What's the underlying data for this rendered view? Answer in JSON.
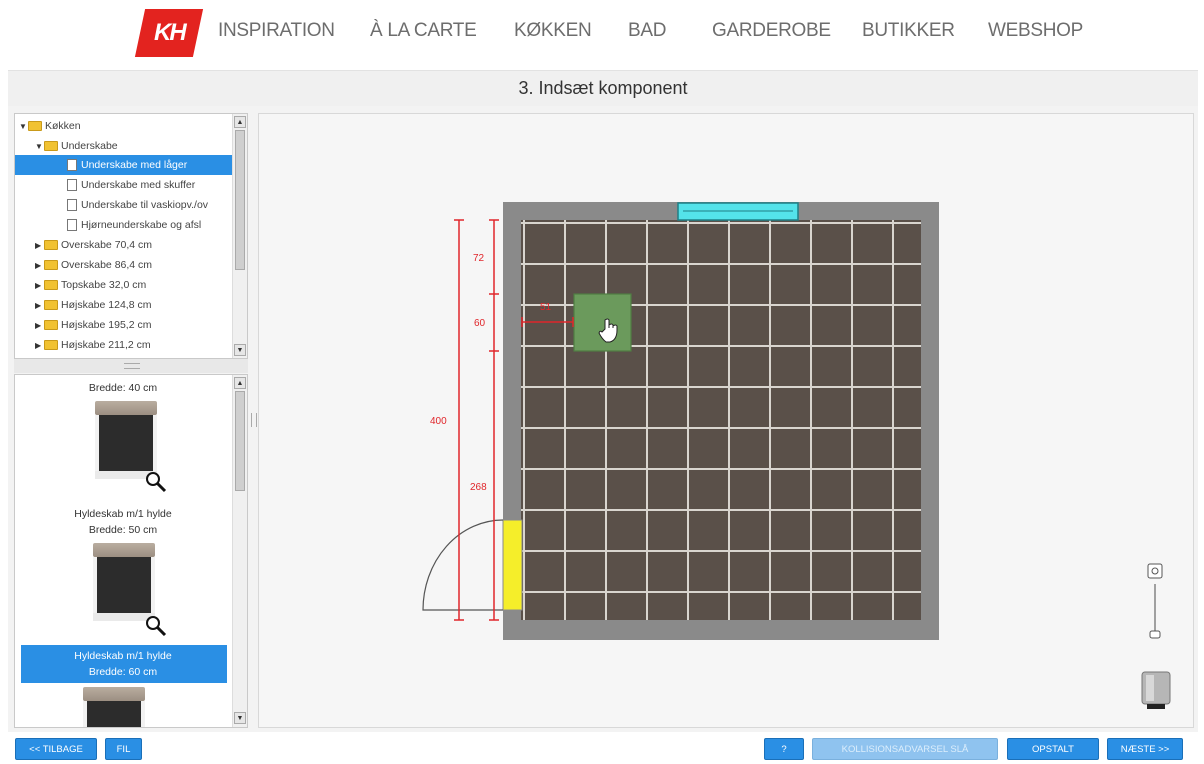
{
  "brand": {
    "logo_text": "KH"
  },
  "nav": [
    "INSPIRATION",
    "À LA CARTE",
    "KØKKEN",
    "BAD",
    "GARDEROBE",
    "BUTIKKER",
    "WEBSHOP"
  ],
  "title": "3. Indsæt komponent",
  "tree": [
    {
      "label": "Køkken",
      "type": "folder",
      "expanded": true
    },
    {
      "label": "Underskabe",
      "type": "folder",
      "expanded": true
    },
    {
      "label": "Underskabe med låger",
      "type": "doc",
      "selected": true
    },
    {
      "label": "Underskabe med skuffer",
      "type": "doc"
    },
    {
      "label": "Underskabe til vaskiopv./ov",
      "type": "doc"
    },
    {
      "label": "Hjørneunderskabe og afsl",
      "type": "doc"
    },
    {
      "label": "Overskabe 70,4 cm",
      "type": "folder"
    },
    {
      "label": "Overskabe 86,4 cm",
      "type": "folder"
    },
    {
      "label": "Topskabe 32,0 cm",
      "type": "folder"
    },
    {
      "label": "Højskabe 124,8 cm",
      "type": "folder"
    },
    {
      "label": "Højskabe 195,2 cm",
      "type": "folder"
    },
    {
      "label": "Højskabe 211,2 cm",
      "type": "folder"
    }
  ],
  "products": {
    "item0_width": "Bredde: 40 cm",
    "item1_name": "Hyldeskab m/1 hylde",
    "item1_width": "Bredde: 50 cm",
    "item2_name": "Hyldeskab m/1 hylde",
    "item2_width": "Bredde: 60 cm"
  },
  "dimensions": {
    "total": "400",
    "top": "72",
    "component_depth": "60",
    "component_offset": "51",
    "bottom": "268"
  },
  "buttons": {
    "back": "<< TILBAGE",
    "file": "FIL",
    "help": "?",
    "collision": "KOLLISIONSADVARSEL SLÅ",
    "elevation": "OPSTALT",
    "next": "NÆSTE >>"
  },
  "colors": {
    "accent": "#2a8fe4",
    "brand_red": "#e3231f",
    "floor": "#5a5049",
    "wall": "#8a8a8a",
    "component": "#6b9a5c",
    "window": "#54e3ea",
    "door": "#f5ee2a",
    "dimension": "#e0262b"
  }
}
